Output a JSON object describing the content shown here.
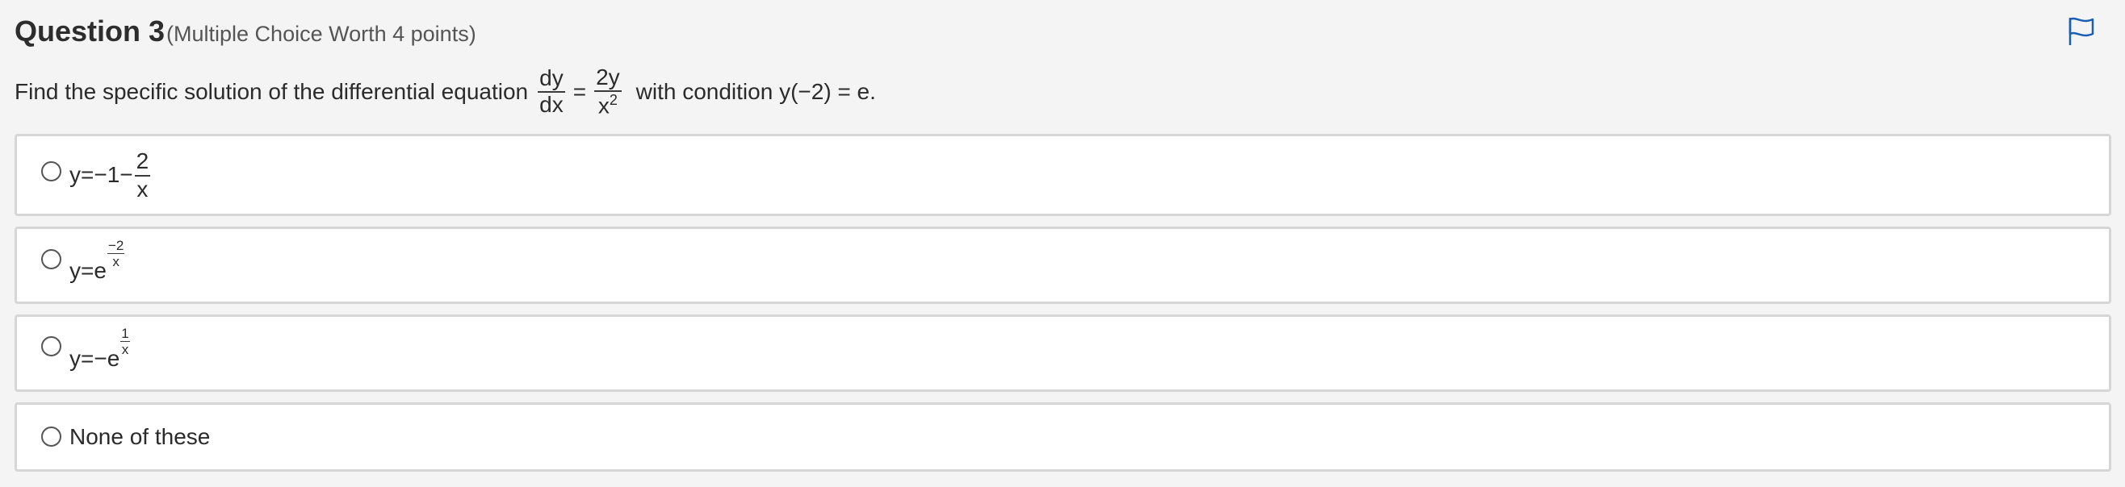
{
  "question": {
    "title": "Question 3",
    "subtitle": "(Multiple Choice Worth 4 points)",
    "prompt_before": "Find the specific solution of the differential equation",
    "lhs_num": "dy",
    "lhs_den": "dx",
    "equals": "=",
    "rhs_num": "2y",
    "rhs_den_base": "x",
    "rhs_den_exp": "2",
    "prompt_after": "with condition y(−2) = e."
  },
  "flag": {
    "icon": "flag-icon",
    "color": "#1a5fb4"
  },
  "options": [
    {
      "prefix": "y=−1−",
      "frac_num": "2",
      "frac_den": "x"
    },
    {
      "prefix": "y=e",
      "exp_num": "−2",
      "exp_den": "x"
    },
    {
      "prefix": "y=−e",
      "exp_num": "1",
      "exp_den": "x"
    },
    {
      "text": "None of these"
    }
  ]
}
